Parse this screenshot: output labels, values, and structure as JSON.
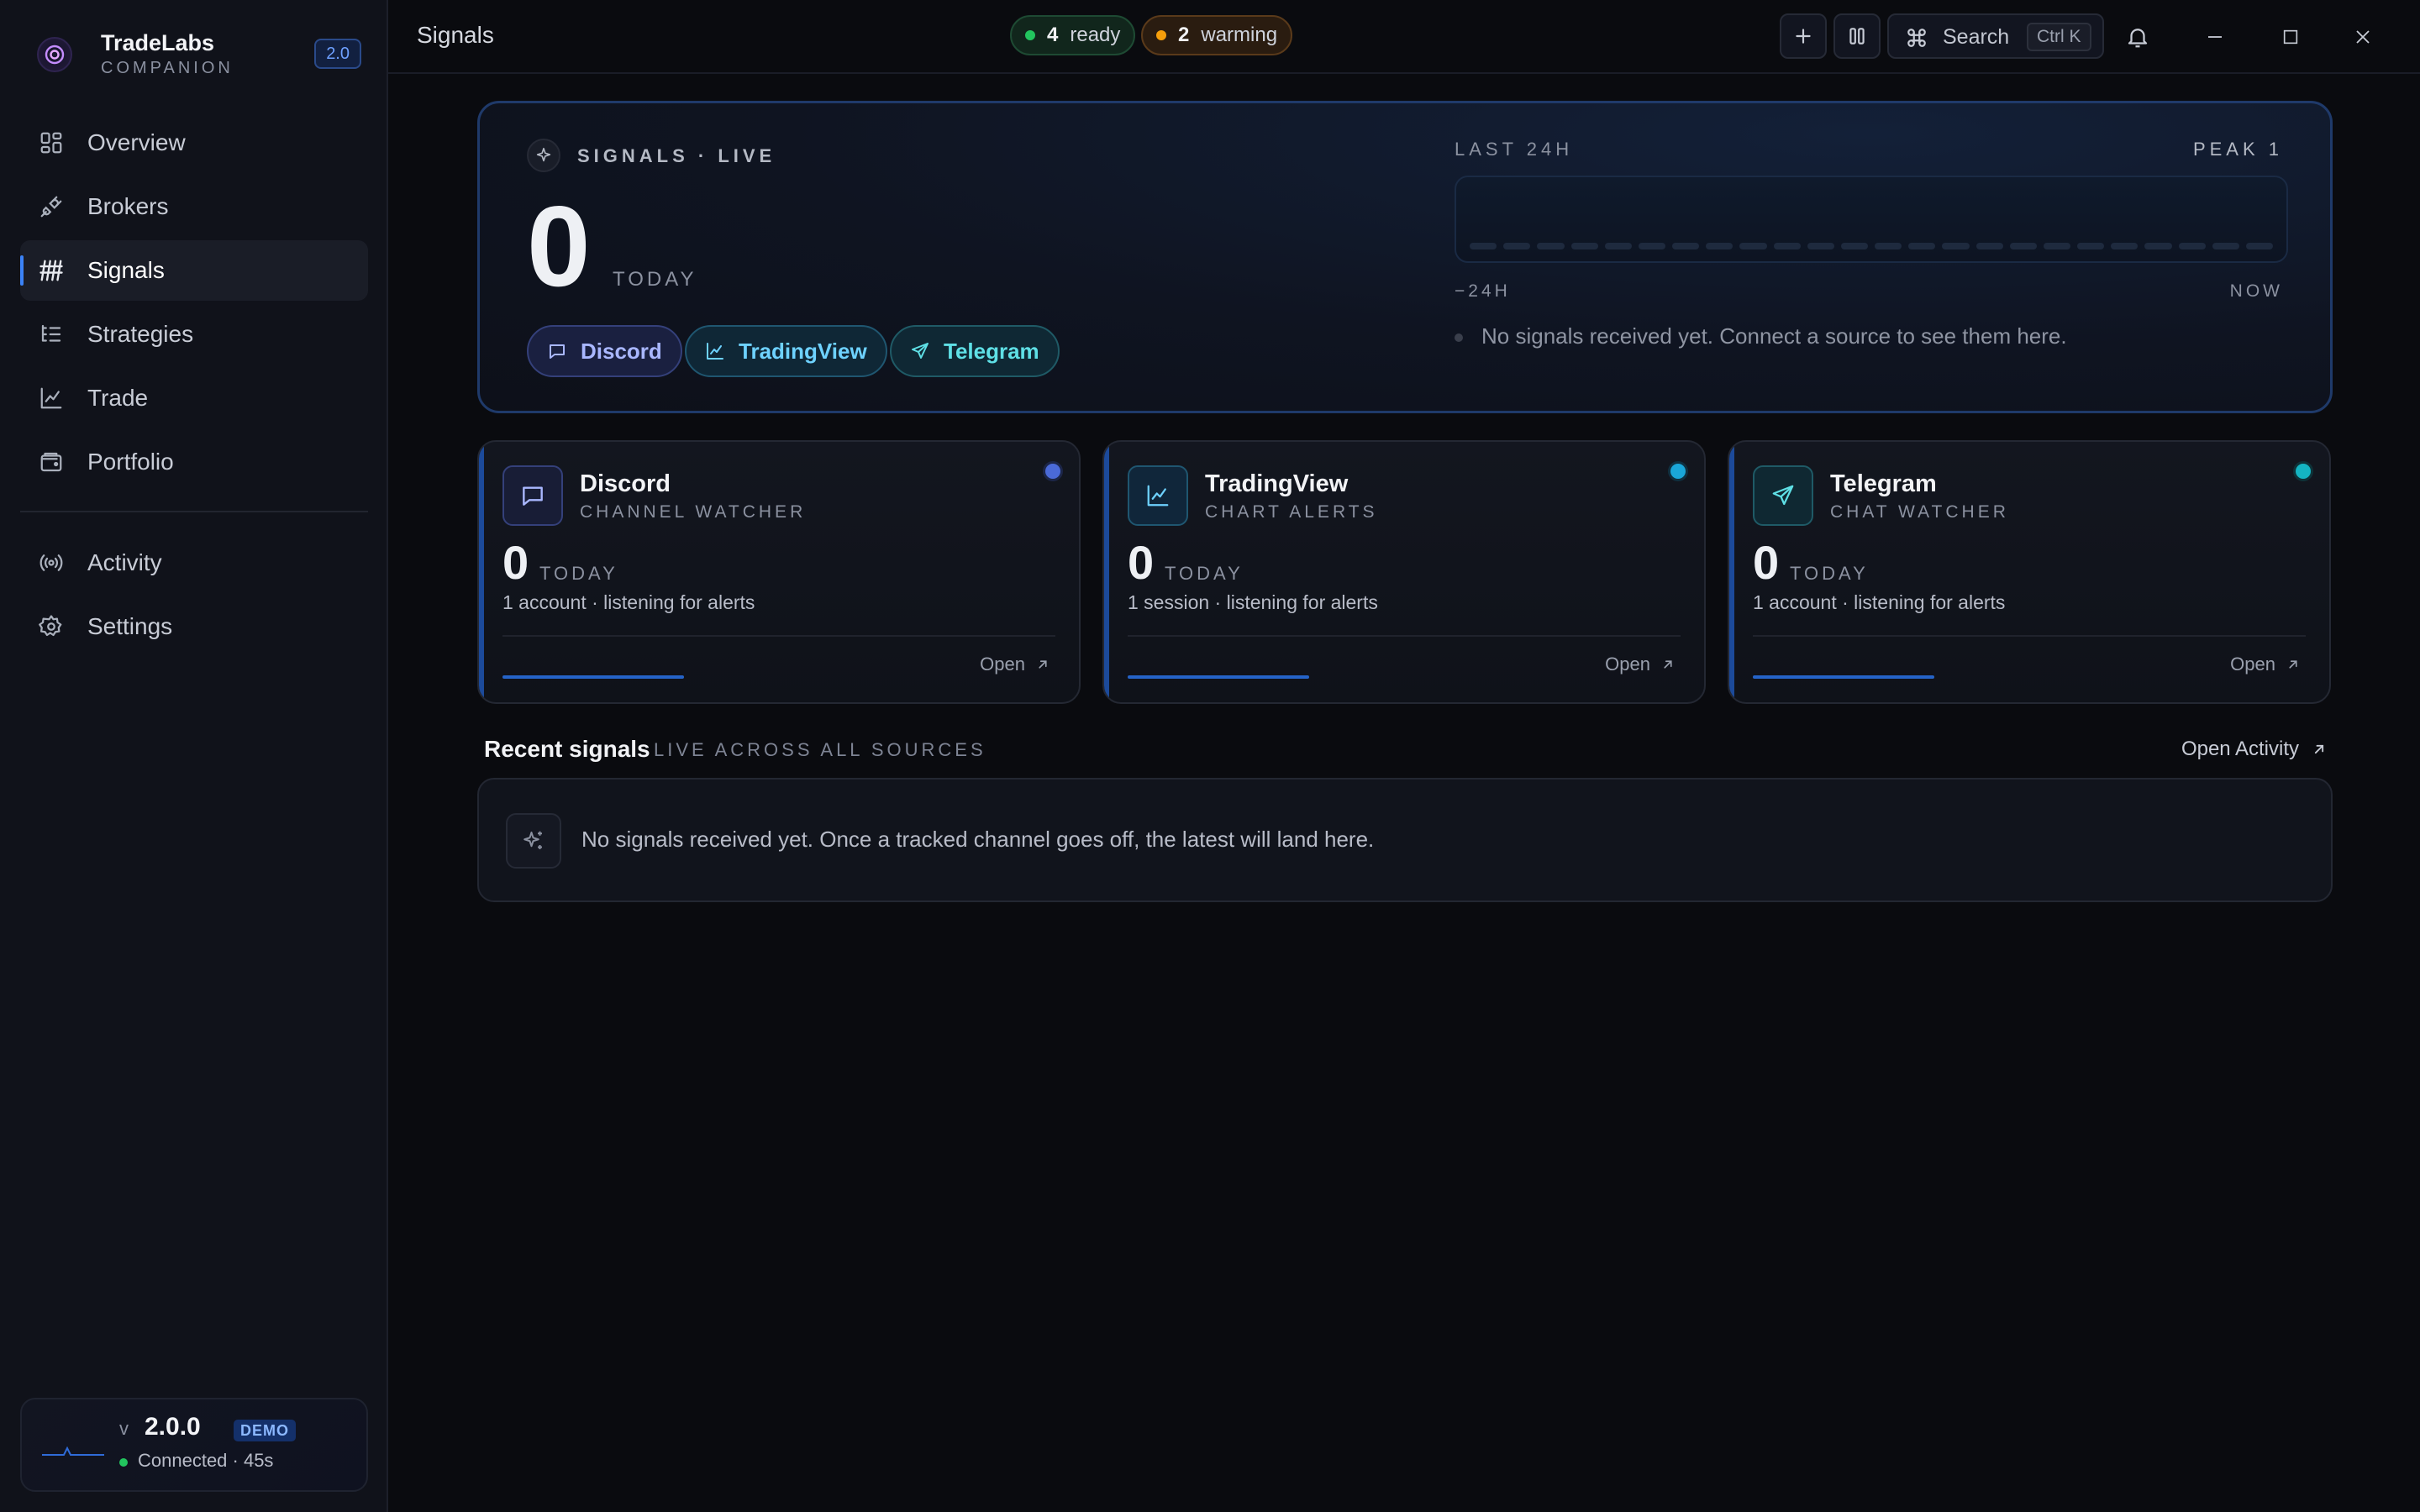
{
  "app": {
    "name": "TradeLabs",
    "subtitle": "COMPANION",
    "version_badge": "2.0"
  },
  "sidebar": {
    "items": [
      {
        "label": "Overview",
        "icon": "grid-icon"
      },
      {
        "label": "Brokers",
        "icon": "plug-icon"
      },
      {
        "label": "Signals",
        "icon": "signals-icon",
        "active": true
      },
      {
        "label": "Strategies",
        "icon": "list-tree-icon"
      },
      {
        "label": "Trade",
        "icon": "line-chart-icon"
      },
      {
        "label": "Portfolio",
        "icon": "wallet-icon"
      }
    ],
    "secondary": [
      {
        "label": "Activity",
        "icon": "broadcast-icon"
      },
      {
        "label": "Settings",
        "icon": "gear-icon"
      }
    ],
    "status": {
      "v": "v",
      "version": "2.0.0",
      "badge": "DEMO",
      "connection": "Connected · 45s"
    }
  },
  "header": {
    "title": "Signals",
    "ready": {
      "count": "4",
      "label": "ready"
    },
    "warming": {
      "count": "2",
      "label": "warming"
    },
    "search": {
      "label": "Search",
      "shortcut": "Ctrl K"
    }
  },
  "hero": {
    "eyebrow": "SIGNALS · LIVE",
    "count": "0",
    "count_label": "TODAY",
    "chips": [
      "Discord",
      "TradingView",
      "Telegram"
    ],
    "window_label": "LAST 24H",
    "peak": "PEAK 1",
    "axis_start": "−24H",
    "axis_end": "NOW",
    "empty": "No signals received yet. Connect a source to see them here."
  },
  "sources": [
    {
      "name": "Discord",
      "kind": "CHANNEL WATCHER",
      "count": "0",
      "count_label": "TODAY",
      "desc": "1 account · listening for alerts",
      "action": "Open"
    },
    {
      "name": "TradingView",
      "kind": "CHART ALERTS",
      "count": "0",
      "count_label": "TODAY",
      "desc": "1 session · listening for alerts",
      "action": "Open"
    },
    {
      "name": "Telegram",
      "kind": "CHAT WATCHER",
      "count": "0",
      "count_label": "TODAY",
      "desc": "1 account · listening for alerts",
      "action": "Open"
    }
  ],
  "recent": {
    "title": "Recent signals",
    "subtitle": "LIVE ACROSS ALL SOURCES",
    "action": "Open Activity",
    "empty": "No signals received yet. Once a tracked channel goes off, the latest will land here."
  },
  "colors": {
    "accent": "#3b82f6",
    "ready": "#22c55e",
    "warming": "#f59e0b",
    "discord": "#4a6ad8",
    "tradingview": "#1aa6d8",
    "telegram": "#14b4c2"
  }
}
